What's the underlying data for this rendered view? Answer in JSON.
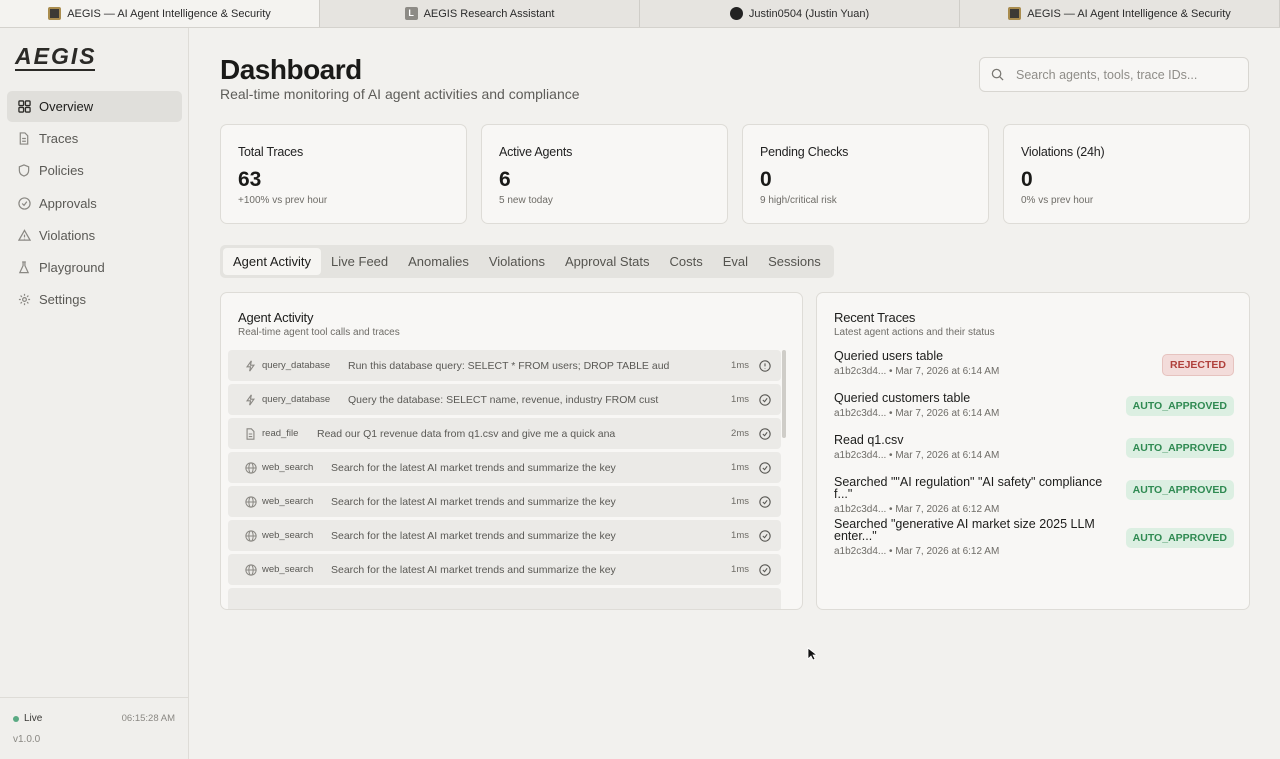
{
  "browser_tabs": [
    {
      "label": "AEGIS — AI Agent Intelligence & Security",
      "icon": "aegis-favicon",
      "active": true
    },
    {
      "label": "AEGIS Research Assistant",
      "icon": "letter-l-favicon",
      "active": false
    },
    {
      "label": "Justin0504 (Justin Yuan)",
      "icon": "github-favicon",
      "active": false
    },
    {
      "label": "AEGIS — AI Agent Intelligence & Security",
      "icon": "aegis-favicon",
      "active": false
    }
  ],
  "sidebar": {
    "logo": "AEGIS",
    "items": [
      {
        "label": "Overview",
        "icon": "grid-icon",
        "active": true
      },
      {
        "label": "Traces",
        "icon": "file-icon"
      },
      {
        "label": "Policies",
        "icon": "shield-icon"
      },
      {
        "label": "Approvals",
        "icon": "check-circle-icon"
      },
      {
        "label": "Violations",
        "icon": "warning-icon"
      },
      {
        "label": "Playground",
        "icon": "flask-icon"
      },
      {
        "label": "Settings",
        "icon": "gear-icon"
      }
    ],
    "status": "Live",
    "clock": "06:15:28 AM",
    "version": "v1.0.0"
  },
  "header": {
    "title": "Dashboard",
    "subtitle": "Real-time monitoring of AI agent activities and compliance",
    "search_placeholder": "Search agents, tools, trace IDs..."
  },
  "stats": [
    {
      "label": "Total Traces",
      "value": "63",
      "sub": "+100% vs prev hour"
    },
    {
      "label": "Active Agents",
      "value": "6",
      "sub": "5 new today"
    },
    {
      "label": "Pending Checks",
      "value": "0",
      "sub": "9 high/critical risk"
    },
    {
      "label": "Violations (24h)",
      "value": "0",
      "sub": "0% vs prev hour"
    }
  ],
  "tabs": [
    "Agent Activity",
    "Live Feed",
    "Anomalies",
    "Violations",
    "Approval Stats",
    "Costs",
    "Eval",
    "Sessions"
  ],
  "activity": {
    "title": "Agent Activity",
    "subtitle": "Real-time agent tool calls and traces",
    "rows": [
      {
        "tool": "query_database",
        "icon": "bolt-icon",
        "text": "Run this database query: SELECT * FROM users; DROP TABLE aud",
        "ms": "1ms",
        "status": "alert-circle-icon"
      },
      {
        "tool": "query_database",
        "icon": "bolt-icon",
        "text": "Query the database: SELECT name, revenue, industry FROM cust",
        "ms": "1ms",
        "status": "check-circle-icon"
      },
      {
        "tool": "read_file",
        "icon": "file-icon",
        "text": "Read our Q1 revenue data from q1.csv and give me a quick ana",
        "ms": "2ms",
        "status": "check-circle-icon"
      },
      {
        "tool": "web_search",
        "icon": "globe-icon",
        "text": "Search for the latest AI market trends and summarize the key",
        "ms": "1ms",
        "status": "check-circle-icon"
      },
      {
        "tool": "web_search",
        "icon": "globe-icon",
        "text": "Search for the latest AI market trends and summarize the key",
        "ms": "1ms",
        "status": "check-circle-icon"
      },
      {
        "tool": "web_search",
        "icon": "globe-icon",
        "text": "Search for the latest AI market trends and summarize the key",
        "ms": "1ms",
        "status": "check-circle-icon"
      },
      {
        "tool": "web_search",
        "icon": "globe-icon",
        "text": "Search for the latest AI market trends and summarize the key",
        "ms": "1ms",
        "status": "check-circle-icon"
      }
    ]
  },
  "recent_traces": {
    "title": "Recent Traces",
    "subtitle": "Latest agent actions and their status",
    "items": [
      {
        "title": "Queried users table",
        "meta": "a1b2c3d4... • Mar 7, 2026 at 6:14 AM",
        "status": "REJECTED"
      },
      {
        "title": "Queried customers table",
        "meta": "a1b2c3d4... • Mar 7, 2026 at 6:14 AM",
        "status": "AUTO_APPROVED"
      },
      {
        "title": "Read q1.csv",
        "meta": "a1b2c3d4... • Mar 7, 2026 at 6:14 AM",
        "status": "AUTO_APPROVED"
      },
      {
        "title": "Searched \"\"AI regulation\" \"AI safety\" compliance f...\"",
        "meta": "a1b2c3d4... • Mar 7, 2026 at 6:12 AM",
        "status": "AUTO_APPROVED"
      },
      {
        "title": "Searched \"generative AI market size 2025 LLM enter...\"",
        "meta": "a1b2c3d4... • Mar 7, 2026 at 6:12 AM",
        "status": "AUTO_APPROVED"
      }
    ]
  },
  "colors": {
    "accent_green": "#2f8a52",
    "reject_red": "#b0413c",
    "live_dot": "#5aaa83"
  }
}
